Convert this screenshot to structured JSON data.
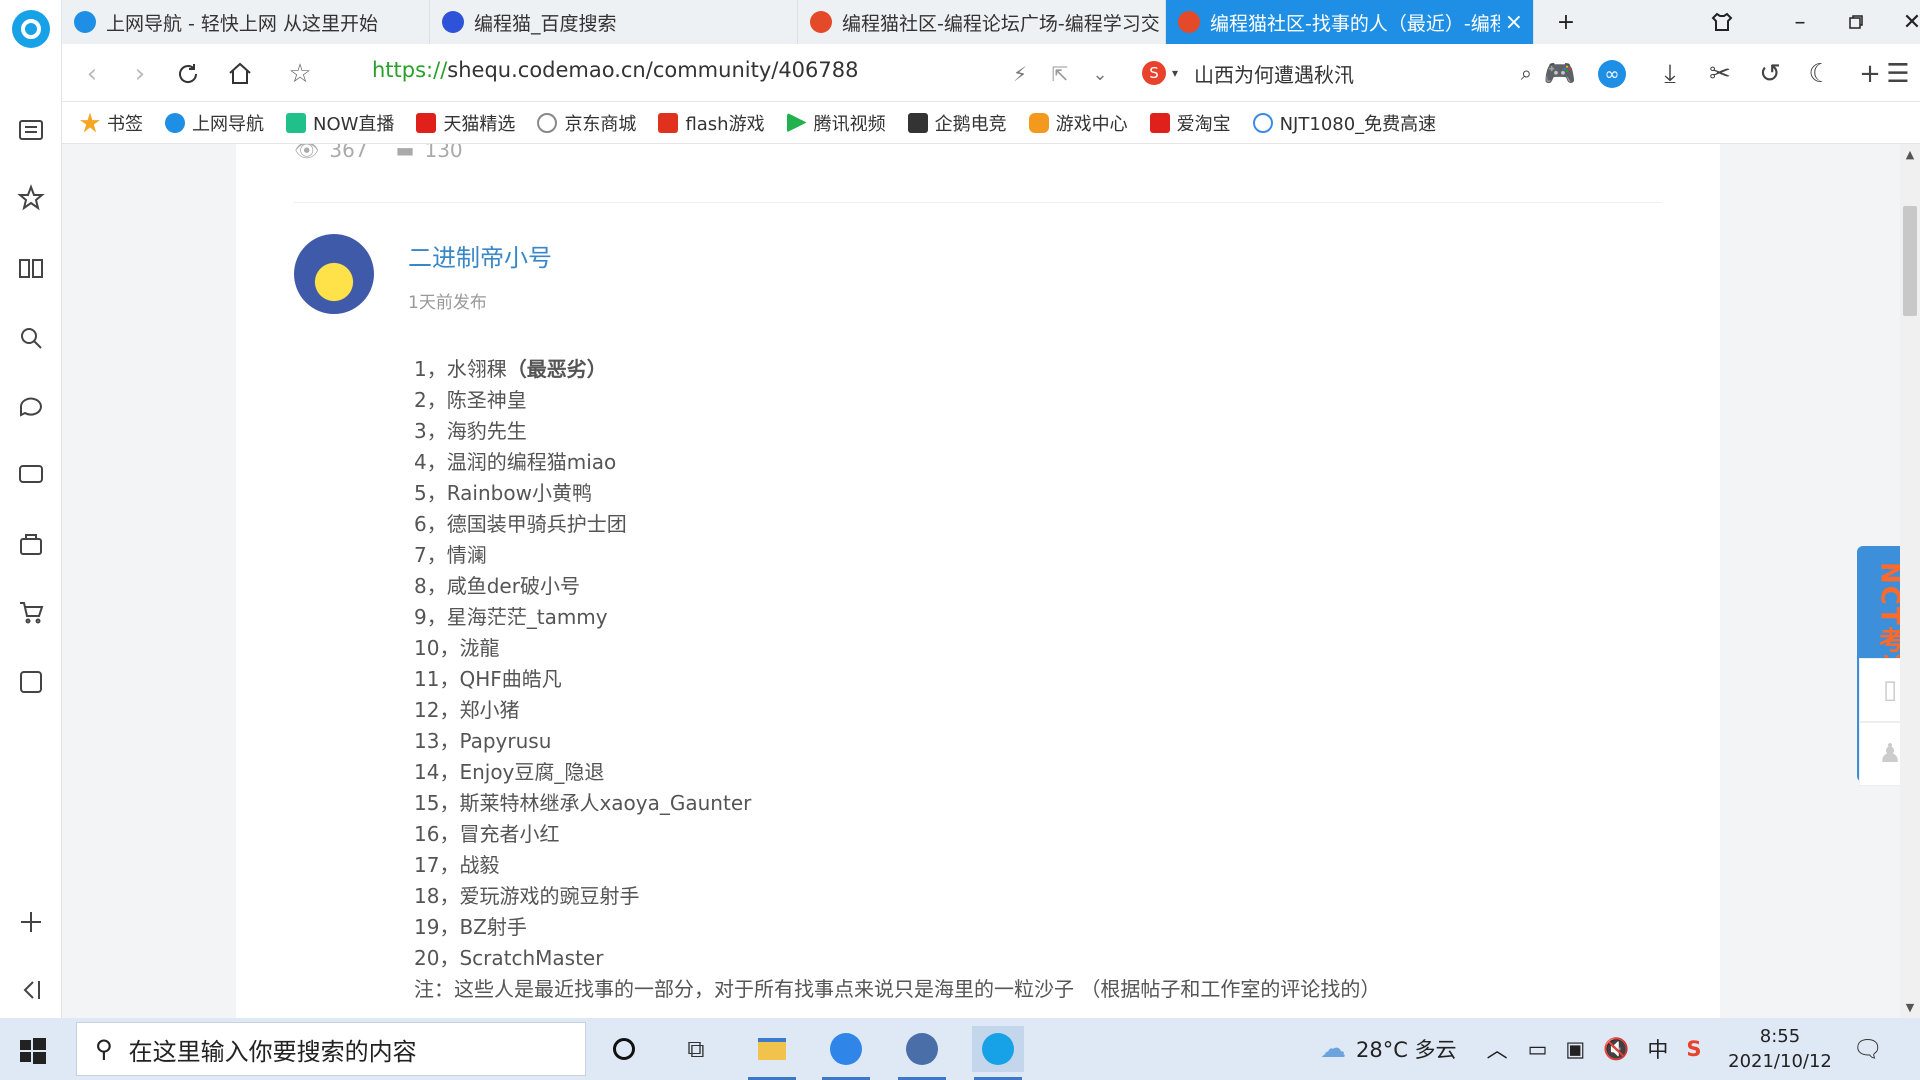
{
  "tabs": [
    {
      "title": "上网导航 - 轻快上网 从这里开始",
      "active": false
    },
    {
      "title": "编程猫_百度搜索",
      "active": false
    },
    {
      "title": "编程猫社区-编程论坛广场-编程学习交",
      "active": false
    },
    {
      "title": "编程猫社区-找事的人（最近）-编程",
      "active": true
    }
  ],
  "address": {
    "scheme": "https://",
    "rest": "shequ.codemao.cn/community/406788",
    "search_text": "山西为何遭遇秋汛"
  },
  "bookmarks": [
    {
      "label": "书签",
      "color": "#f5a623"
    },
    {
      "label": "上网导航",
      "color": "#1f8fe6"
    },
    {
      "label": "NOW直播",
      "color": "#21c08b"
    },
    {
      "label": "天猫精选",
      "color": "#e0201b"
    },
    {
      "label": "京东商城",
      "color": "#888888"
    },
    {
      "label": "flash游戏",
      "color": "#e0301e"
    },
    {
      "label": "腾讯视频",
      "color": "#22b14c"
    },
    {
      "label": "企鹅电竞",
      "color": "#333333"
    },
    {
      "label": "游戏中心",
      "color": "#f39a1e"
    },
    {
      "label": "爱淘宝",
      "color": "#e0201b"
    },
    {
      "label": "NJT1080_免费高速",
      "color": "#3c8be6"
    }
  ],
  "post": {
    "views": "367",
    "comments": "130",
    "author": "二进制帝小号",
    "posted": "1天前发布",
    "items": [
      {
        "text": "1，水翎稞",
        "bold": "（最恶劣）"
      },
      {
        "text": "2，陈圣神皇"
      },
      {
        "text": "3，海豹先生"
      },
      {
        "text": "4，温润的编程猫miao"
      },
      {
        "text": " 5，Rainbow小黄鸭"
      },
      {
        "text": "6，德国装甲骑兵护士团"
      },
      {
        "text": "7，情澜"
      },
      {
        "text": " 8，咸鱼der破小号"
      },
      {
        "text": "9，星海茫茫_tammy"
      },
      {
        "text": "10，泷龍"
      },
      {
        "text": "11，QHF曲皓凡"
      },
      {
        "text": "12，郑小猪"
      },
      {
        "text": "13，Papyrusu"
      },
      {
        "text": "14，Enjoy豆腐_隐退"
      },
      {
        "text": "15，斯莱特林继承人xaoya_Gaunter"
      },
      {
        "text": "16，冒充者小红"
      },
      {
        "text": "17，战毅"
      },
      {
        "text": "18，爱玩游戏的豌豆射手"
      },
      {
        "text": "19，BZ射手"
      },
      {
        "text": "20，ScratchMaster"
      },
      {
        "text": "注：这些人是最近找事的一部分，对于所有找事点来说只是海里的一粒沙子 （根据帖子和工作室的评论找的）"
      }
    ]
  },
  "promo": "NCT考前冲刺卷",
  "taskbar": {
    "search_placeholder": "在这里输入你要搜索的内容",
    "weather": "28°C  多云",
    "ime": "中",
    "time": "8:55",
    "date": "2021/10/12"
  }
}
